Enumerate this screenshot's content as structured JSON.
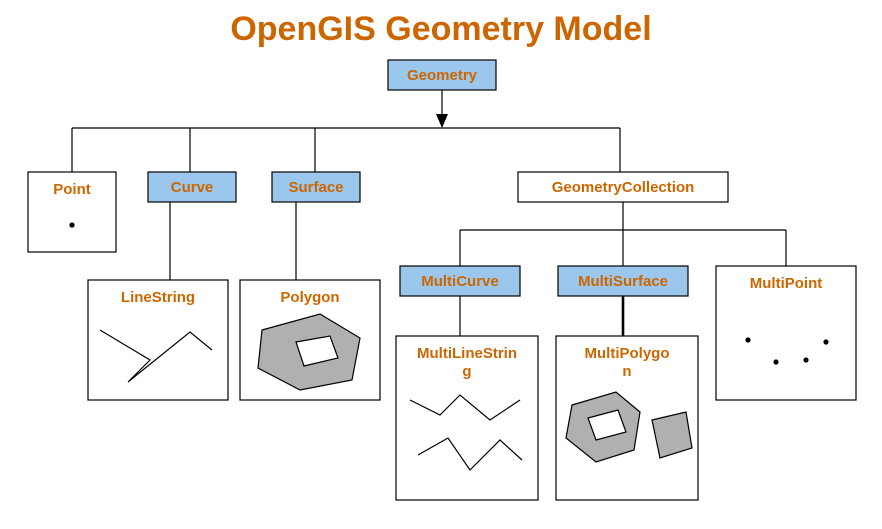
{
  "title": "OpenGIS Geometry Model",
  "root": "Geometry",
  "level1": {
    "point": "Point",
    "curve": "Curve",
    "surface": "Surface",
    "geomcoll": "GeometryCollection"
  },
  "level2": {
    "linestring": "LineString",
    "polygon": "Polygon",
    "multicurve": "MultiCurve",
    "multisurface": "MultiSurface",
    "multipoint": "MultiPoint"
  },
  "level3": {
    "multilinestring": "MultiLineString",
    "multipolygon": "MultiPolygon"
  }
}
